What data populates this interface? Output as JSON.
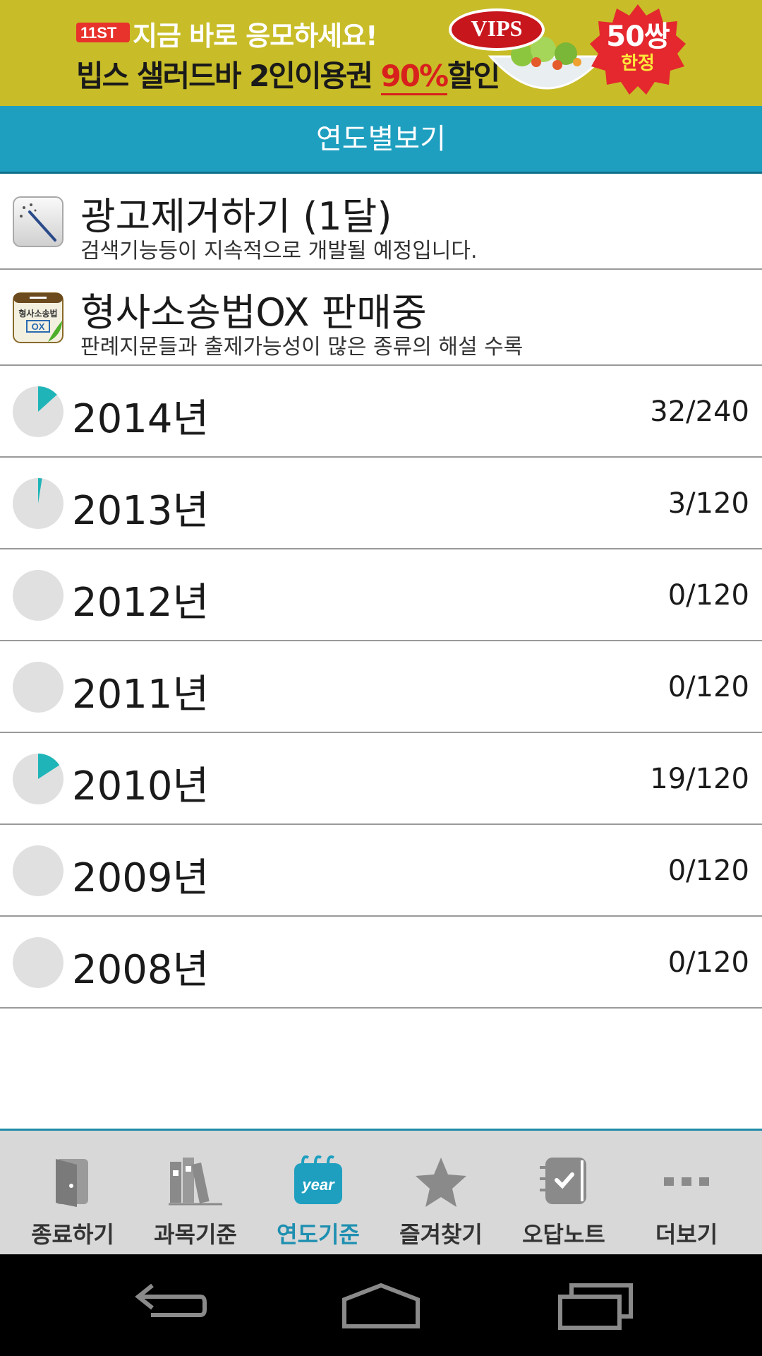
{
  "ad": {
    "line1": "지금 바로 응모하세요!",
    "line2_prefix": "빕스 샐러드바 2인이용권 ",
    "line2_percent": "90%",
    "line2_suffix": "할인",
    "brand": "VIPS",
    "badge_count": "50쌍",
    "badge_limit": "한정"
  },
  "header": {
    "title": "연도별보기"
  },
  "promos": [
    {
      "title": "광고제거하기 (1달)",
      "subtitle": "검색기능등이 지속적으로 개발될 예정입니다.",
      "icon": "magic-wand-icon"
    },
    {
      "title": "형사소송법OX 판매중",
      "subtitle": "판례지문들과 출제가능성이 많은 종류의 해설 수록",
      "icon": "ox-app-icon"
    }
  ],
  "years": [
    {
      "label": "2014년",
      "count": "32/240",
      "progress": 0.1333
    },
    {
      "label": "2013년",
      "count": "3/120",
      "progress": 0.025
    },
    {
      "label": "2012년",
      "count": "0/120",
      "progress": 0
    },
    {
      "label": "2011년",
      "count": "0/120",
      "progress": 0
    },
    {
      "label": "2010년",
      "count": "19/120",
      "progress": 0.1583
    },
    {
      "label": "2009년",
      "count": "0/120",
      "progress": 0
    },
    {
      "label": "2008년",
      "count": "0/120",
      "progress": 0
    }
  ],
  "nav": {
    "items": [
      {
        "label": "종료하기",
        "icon": "exit-door-icon",
        "active": false
      },
      {
        "label": "과목기준",
        "icon": "books-icon",
        "active": false
      },
      {
        "label": "연도기준",
        "icon": "year-calendar-icon",
        "active": true,
        "icon_text": "year"
      },
      {
        "label": "즐겨찾기",
        "icon": "star-icon",
        "active": false
      },
      {
        "label": "오답노트",
        "icon": "notebook-check-icon",
        "active": false
      },
      {
        "label": "더보기",
        "icon": "more-dots-icon",
        "active": false
      }
    ]
  },
  "colors": {
    "header": "#1e9fc0",
    "progress": "#1fb5b8",
    "pie_bg": "#e0e0e0",
    "nav_active": "#1e8fb0",
    "ad_bg": "#c8bd28"
  }
}
